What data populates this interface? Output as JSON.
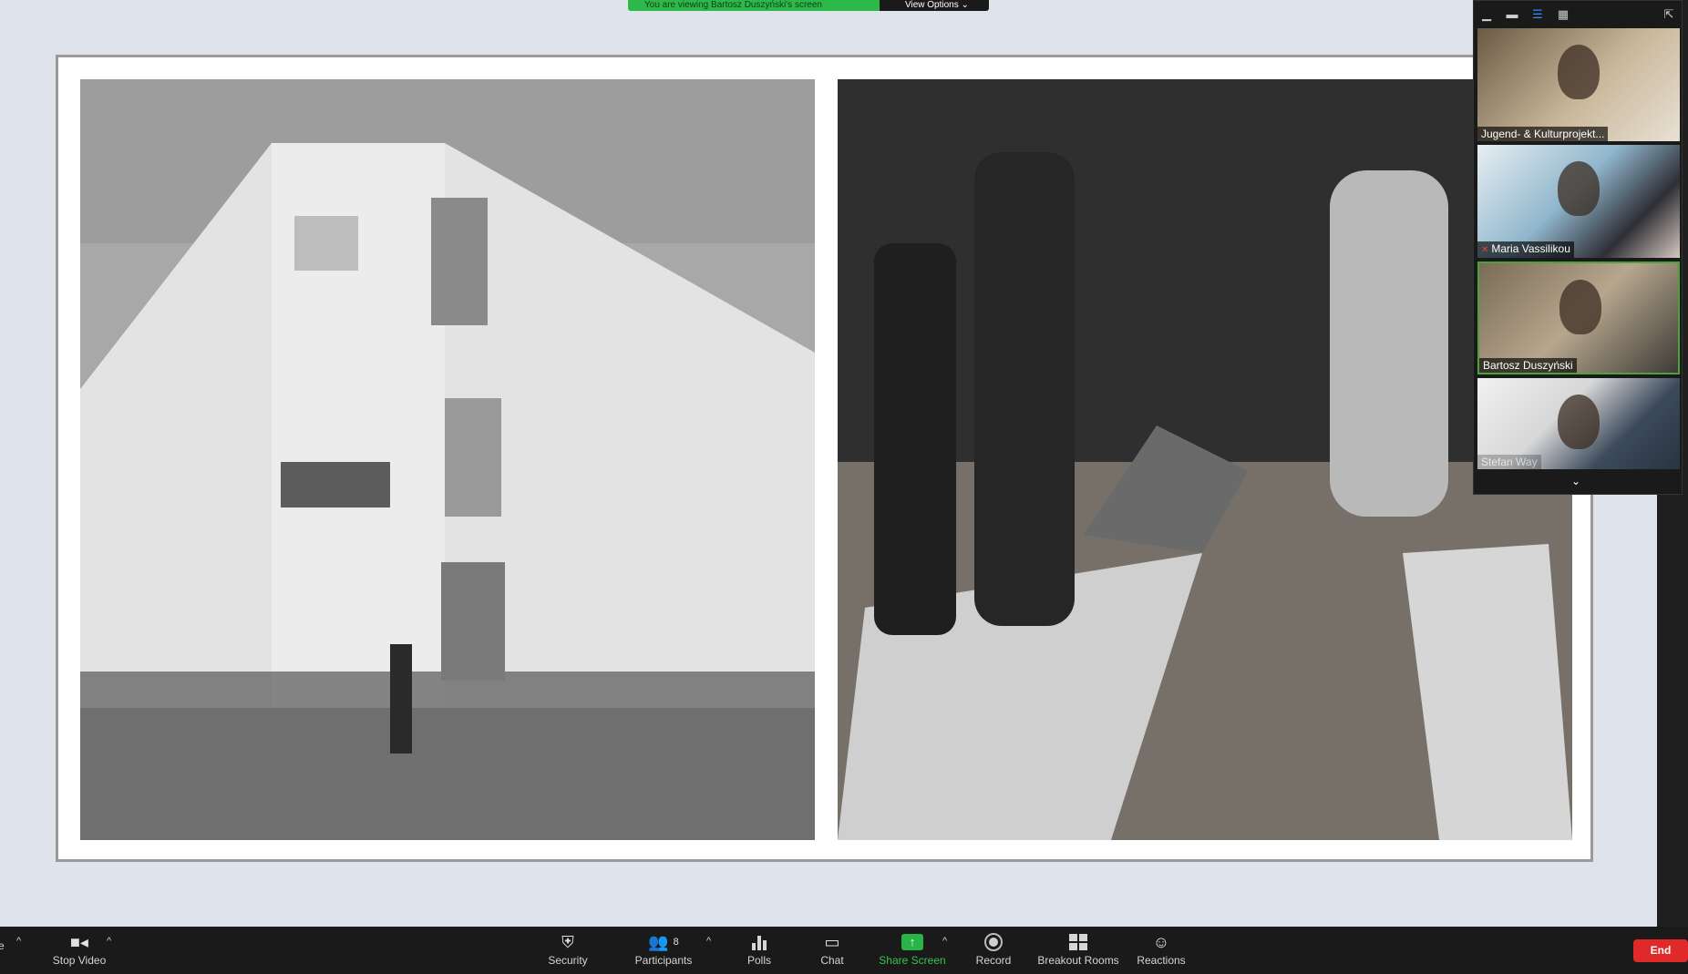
{
  "share_banner": {
    "viewing_text": "You are viewing Bartosz Duszyński's screen",
    "view_options_label": "View Options ⌄"
  },
  "video_panel": {
    "participants": [
      {
        "name": "Jugend- & Kulturprojekt...",
        "muted": false
      },
      {
        "name": "Maria Vassilikou",
        "muted": true
      },
      {
        "name": "Bartosz Duszyński",
        "muted": false,
        "active_speaker": true
      },
      {
        "name": "Stefan Way",
        "muted": false
      }
    ],
    "more_chevron": "⌄"
  },
  "toolbar": {
    "left_fragment": "e",
    "stop_video_label": "Stop Video",
    "security_label": "Security",
    "participants_label": "Participants",
    "participants_count": "8",
    "polls_label": "Polls",
    "chat_label": "Chat",
    "share_screen_label": "Share Screen",
    "record_label": "Record",
    "breakout_rooms_label": "Breakout Rooms",
    "reactions_label": "Reactions",
    "end_label": "End",
    "caret": "^"
  },
  "colors": {
    "toolbar_bg": "#1a1a1a",
    "share_green": "#35c24e",
    "end_red": "#e02a2a",
    "active_speaker_border": "#4ca33e",
    "page_bg": "#dfe3ec"
  }
}
